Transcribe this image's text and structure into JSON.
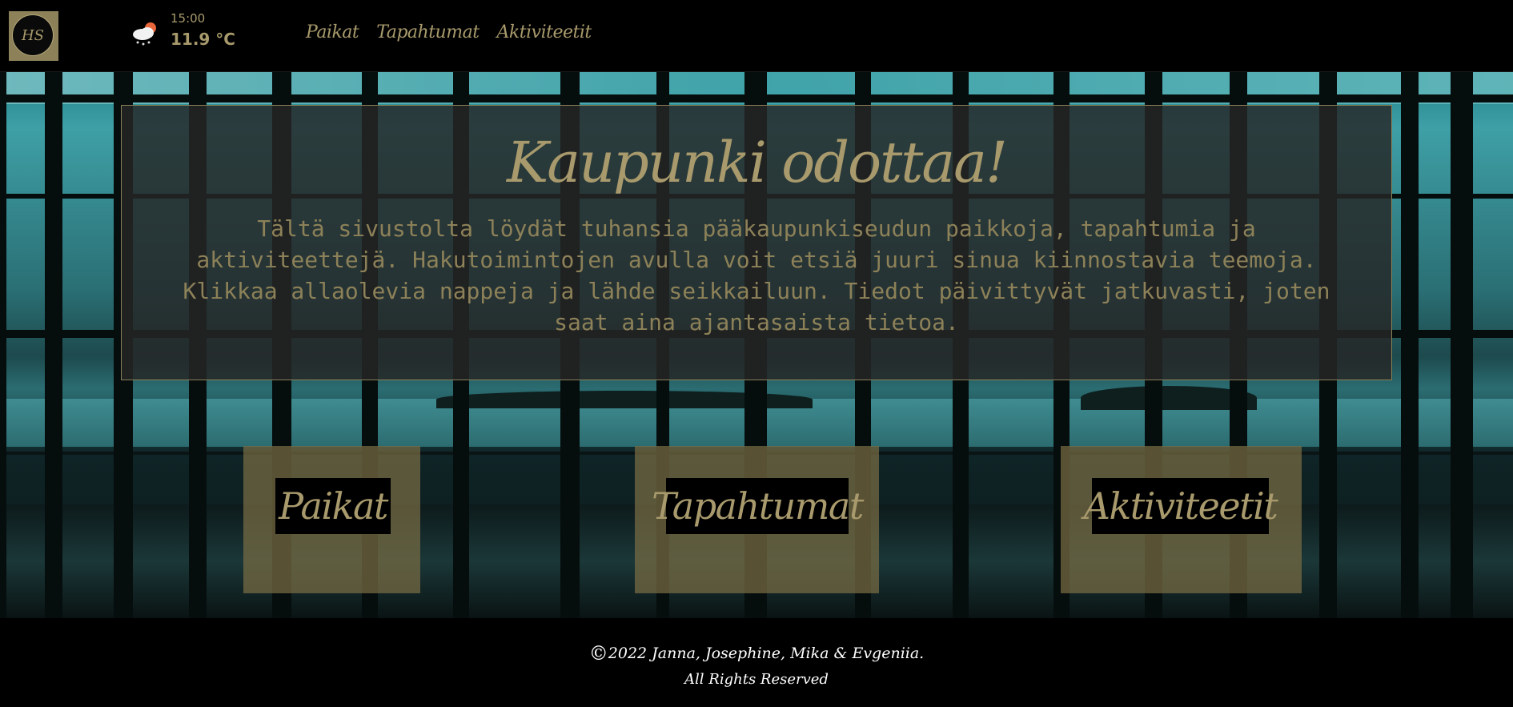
{
  "header": {
    "logo_text": "HS",
    "weather": {
      "icon": "cloud-sun-rain-icon",
      "time": "15:00",
      "temperature": "11.9 °C"
    },
    "nav": [
      "Paikat",
      "Tapahtumat",
      "Aktiviteetit"
    ]
  },
  "intro": {
    "title": "Kaupunki odottaa!",
    "text": "Tältä sivustolta löydät tuhansia pääkaupunkiseudun paikkoja, tapahtumia ja aktiviteettejä. Hakutoimintojen avulla voit etsiä juuri sinua kiinnostavia teemoja. Klikkaa allaolevia nappeja ja lähde seikkailuun. Tiedot päivittyvät jatkuvasti, joten saat aina ajantasaista tietoa."
  },
  "buttons": [
    "Paikat",
    "Tapahtumat",
    "Aktiviteetit"
  ],
  "footer": {
    "copyright_symbol": "©",
    "line1": "2022 Janna, Josephine, Mika & Evgeniia.",
    "line2": "All Rights Reserved"
  },
  "colors": {
    "gold": "#a89a6c",
    "gold_dark": "#8c8158",
    "background": "#000000"
  }
}
